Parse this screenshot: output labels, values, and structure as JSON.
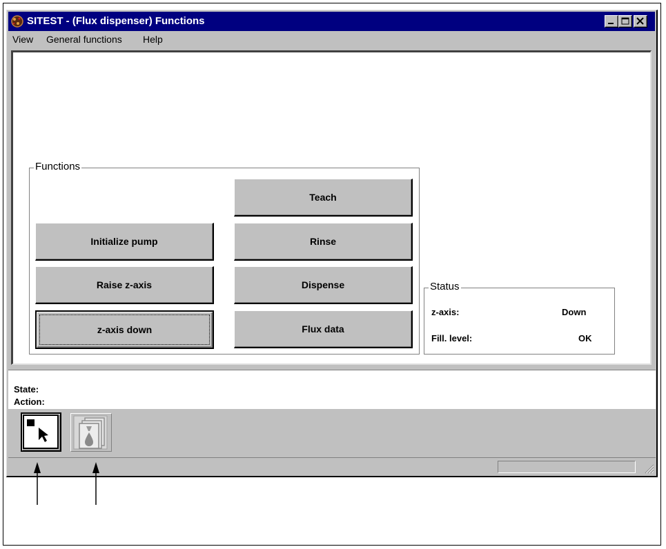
{
  "window": {
    "title": "SITEST - (Flux dispenser) Functions"
  },
  "menu": {
    "view": "View",
    "general": "General functions",
    "help": "Help"
  },
  "functions": {
    "label": "Functions",
    "teach": "Teach",
    "init_pump": "Initialize pump",
    "rinse": "Rinse",
    "raise_z": "Raise z-axis",
    "dispense": "Dispense",
    "z_down": "z-axis down",
    "flux_data": "Flux data"
  },
  "status": {
    "label": "Status",
    "z_axis_label": "z-axis:",
    "z_axis_value": "Down",
    "fill_label": "Fill. level:",
    "fill_value": "OK"
  },
  "info": {
    "state_label": "State:",
    "action_label": "Action:"
  },
  "toolbar": {
    "select_icon": "select-pointer-icon",
    "dispense_icon": "flux-dispenser-icon"
  },
  "colors": {
    "titlebar": "#000080",
    "face": "#c0c0c0"
  }
}
